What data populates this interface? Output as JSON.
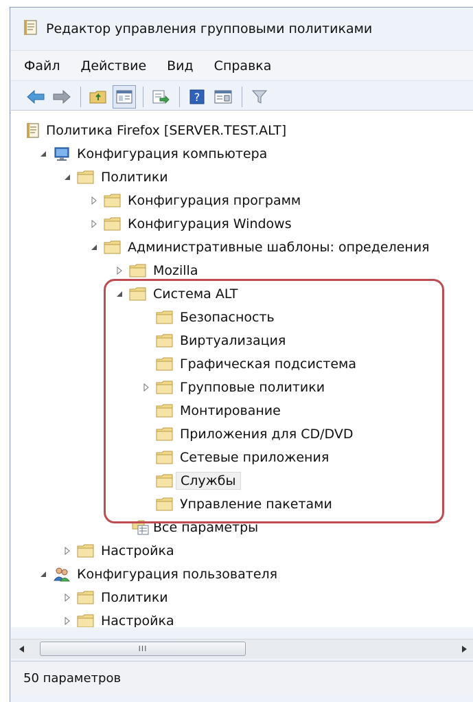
{
  "window": {
    "title": "Редактор управления групповыми политиками"
  },
  "menu": [
    {
      "label": "Файл"
    },
    {
      "label": "Действие"
    },
    {
      "label": "Вид"
    },
    {
      "label": "Справка"
    }
  ],
  "toolbar": {
    "buttons": [
      "back-arrow-icon",
      "forward-arrow-icon",
      "up-folder-icon",
      "show-hide-tree-icon",
      "export-list-icon",
      "help-icon",
      "properties-icon",
      "filter-icon"
    ]
  },
  "tree": {
    "root": "Политика Firefox [SERVER.TEST.ALT]",
    "computer_config": "Конфигурация компьютера",
    "policies": "Политики",
    "software_config": "Конфигурация программ",
    "windows_config": "Конфигурация Windows",
    "admin_templates": "Административные шаблоны: определения",
    "mozilla": "Mozilla",
    "alt_system": "Система ALT",
    "alt_children": [
      "Безопасность",
      "Виртуализация",
      "Графическая подсистема",
      "Групповые политики",
      "Монтирование",
      "Приложения для CD/DVD",
      "Сетевые приложения",
      "Службы",
      "Управление пакетами"
    ],
    "all_settings": "Все параметры",
    "preferences": "Настройка",
    "user_config": "Конфигурация пользователя",
    "user_policies": "Политики",
    "user_preferences": "Настройка",
    "selected": "Службы"
  },
  "scrollbar": {
    "grip": "III"
  },
  "status": {
    "text": "50 параметров"
  }
}
